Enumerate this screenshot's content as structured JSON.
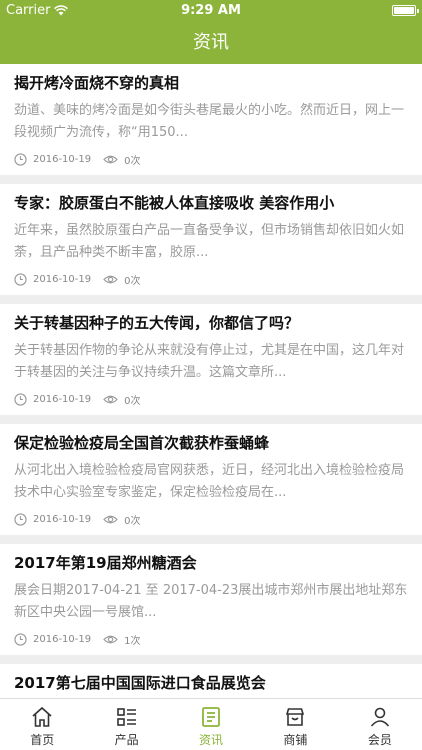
{
  "status_bar": {
    "carrier": "Carrier",
    "time": "9:29 AM"
  },
  "header": {
    "title": "资讯"
  },
  "articles": [
    {
      "title": "揭开烤冷面烧不穿的真相",
      "summary": " 劲道、美味的烤冷面是如今街头巷尾最火的小吃。然而近日，网上一段视频广为流传，称“用150...",
      "date": "2016-10-19",
      "views": "0次"
    },
    {
      "title": "专家：胶原蛋白不能被人体直接吸收 美容作用小",
      "summary": " 近年来，虽然胶原蛋白产品一直备受争议，但市场销售却依旧如火如荼，且产品种类不断丰富，胶原...",
      "date": "2016-10-19",
      "views": "0次"
    },
    {
      "title": "关于转基因种子的五大传闻，你都信了吗？",
      "summary": "关于转基因作物的争论从来就没有停止过，尤其是在中国，这几年对于转基因的关注与争议持续升温。这篇文章所...",
      "date": "2016-10-19",
      "views": "0次"
    },
    {
      "title": "保定检验检疫局全国首次截获柞蚕蛹蜂",
      "summary": "从河北出入境检验检疫局官网获悉，近日，经河北出入境检验检疫局技术中心实验室专家鉴定，保定检验检疫局在...",
      "date": "2016-10-19",
      "views": "0次"
    },
    {
      "title": "2017年第19届郑州糖酒会",
      "summary": "展会日期2017-04-21 至 2017-04-23展出城市郑州市展出地址郑东新区中央公园一号展馆...",
      "date": "2016-10-19",
      "views": "1次"
    }
  ],
  "partial_article": {
    "title": "2017第七届中国国际进口食品展览会"
  },
  "tabs": [
    {
      "label": "首页",
      "icon": "home-icon"
    },
    {
      "label": "产品",
      "icon": "list-icon"
    },
    {
      "label": "资讯",
      "icon": "news-icon",
      "active": true
    },
    {
      "label": "商铺",
      "icon": "store-icon"
    },
    {
      "label": "会员",
      "icon": "user-icon"
    }
  ],
  "colors": {
    "accent": "#8cb43a",
    "background": "#eeeeee",
    "summary_text": "#9a9a9a"
  }
}
